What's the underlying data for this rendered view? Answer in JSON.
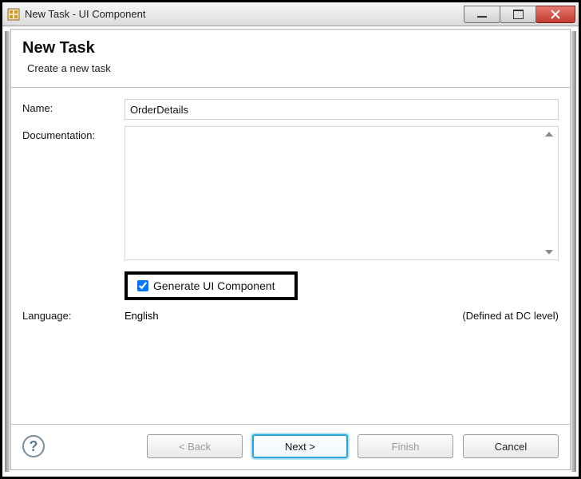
{
  "window": {
    "title": "New Task - UI Component"
  },
  "header": {
    "title": "New Task",
    "subtitle": "Create a new task"
  },
  "form": {
    "name_label": "Name:",
    "name_value": "OrderDetails",
    "doc_label": "Documentation:",
    "doc_value": "",
    "generate_label": "Generate UI Component",
    "generate_checked": true,
    "lang_label": "Language:",
    "lang_value": "English",
    "lang_note": "(Defined at DC level)"
  },
  "buttons": {
    "back": "< Back",
    "next": "Next >",
    "finish": "Finish",
    "cancel": "Cancel"
  }
}
